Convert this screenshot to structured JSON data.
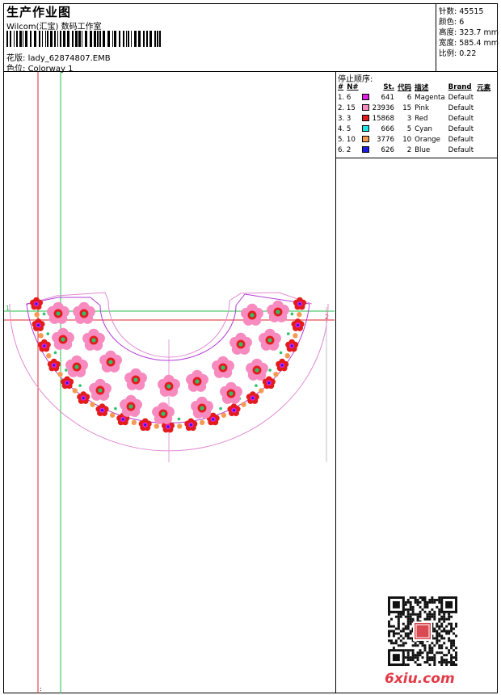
{
  "header": {
    "title": "生产作业图",
    "company": "Wilcom(汇宝) 数码工作室",
    "file_label": "花版:",
    "file_name": "lady_62874807.EMB",
    "colorway_label": "色位:",
    "colorway_name": "Colorway 1"
  },
  "stats": [
    {
      "label": "针数:",
      "value": "45515"
    },
    {
      "label": "颜色:",
      "value": "6"
    },
    {
      "label": "高度:",
      "value": "323.7 mm"
    },
    {
      "label": "宽度:",
      "value": "585.4 mm"
    },
    {
      "label": "比例:",
      "value": "0.22"
    }
  ],
  "sequence": {
    "title": "停止顺序:",
    "columns": [
      "#",
      "N#",
      "St.",
      "代码",
      "描述",
      "Brand",
      "元素"
    ],
    "rows": [
      {
        "idx": "1. 6",
        "color": "#e020e0",
        "stitches": "641",
        "code": "6",
        "desc": "Magenta",
        "brand": "Default"
      },
      {
        "idx": "2. 15",
        "color": "#f78bbf",
        "stitches": "23936",
        "code": "15",
        "desc": "Pink",
        "brand": "Default"
      },
      {
        "idx": "3. 3",
        "color": "#e31b1b",
        "stitches": "15868",
        "code": "3",
        "desc": "Red",
        "brand": "Default"
      },
      {
        "idx": "4. 5",
        "color": "#22e4e4",
        "stitches": "666",
        "code": "5",
        "desc": "Cyan",
        "brand": "Default"
      },
      {
        "idx": "5. 10",
        "color": "#f59a52",
        "stitches": "3776",
        "code": "10",
        "desc": "Orange",
        "brand": "Default"
      },
      {
        "idx": "6. 2",
        "color": "#1c1ce0",
        "stitches": "626",
        "code": "2",
        "desc": "Blue",
        "brand": "Default"
      }
    ]
  },
  "design": {
    "markers": {
      "left": "1",
      "right": "2",
      "bottom": ":"
    },
    "colors": {
      "guide_red": "#e0262e",
      "guide_green": "#22c24a",
      "outline_purple": "#b43cd6",
      "outline_pink": "#e08ad2"
    }
  },
  "watermark": "6xiu.com"
}
